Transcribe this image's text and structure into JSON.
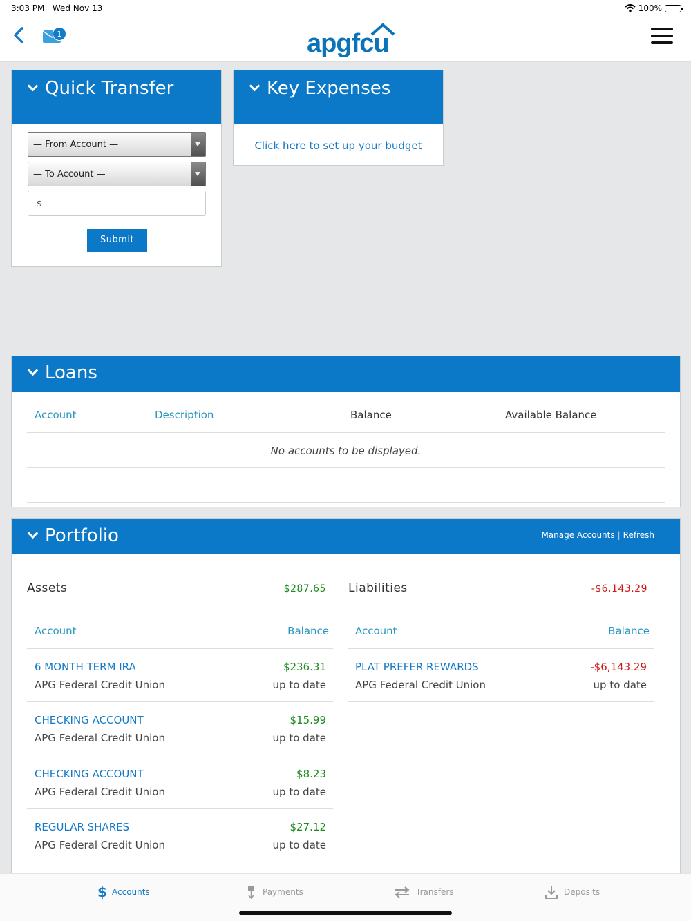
{
  "status": {
    "time": "3:03 PM",
    "date": "Wed Nov 13",
    "battery": "100%"
  },
  "header": {
    "logo_text": "apgfcu",
    "mail_count": "1"
  },
  "quick_transfer": {
    "title": "Quick Transfer",
    "from_account": "— From Account —",
    "to_account": "— To Account —",
    "amount_prefix": "$",
    "submit_label": "Submit"
  },
  "key_expenses": {
    "title": "Key Expenses",
    "link": "Click here to set up your budget"
  },
  "loans": {
    "title": "Loans",
    "columns": [
      "Account",
      "Description",
      "Balance",
      "Available Balance"
    ],
    "empty": "No accounts to be displayed."
  },
  "portfolio": {
    "title": "Portfolio",
    "manage_link": "Manage Accounts",
    "separator": "|",
    "refresh_link": "Refresh",
    "assets": {
      "title": "Assets",
      "total": "$287.65",
      "col_account": "Account",
      "col_balance": "Balance",
      "rows": [
        {
          "name": "6 MONTH TERM IRA",
          "institution": "APG Federal Credit Union",
          "balance": "$236.31",
          "status": "up to date"
        },
        {
          "name": "CHECKING ACCOUNT",
          "institution": "APG Federal Credit Union",
          "balance": "$15.99",
          "status": "up to date"
        },
        {
          "name": "CHECKING ACCOUNT",
          "institution": "APG Federal Credit Union",
          "balance": "$8.23",
          "status": "up to date"
        },
        {
          "name": "REGULAR SHARES",
          "institution": "APG Federal Credit Union",
          "balance": "$27.12",
          "status": "up to date"
        }
      ]
    },
    "liabilities": {
      "title": "Liabilities",
      "total": "-$6,143.29",
      "col_account": "Account",
      "col_balance": "Balance",
      "rows": [
        {
          "name": "PLAT PREFER REWARDS",
          "institution": "APG Federal Credit Union",
          "balance": "-$6,143.29",
          "status": "up to date"
        }
      ]
    }
  },
  "tabs": [
    {
      "label": "Accounts",
      "icon": "dollar-icon",
      "active": true
    },
    {
      "label": "Payments",
      "icon": "payments-icon",
      "active": false
    },
    {
      "label": "Transfers",
      "icon": "transfer-arrows-icon",
      "active": false
    },
    {
      "label": "Deposits",
      "icon": "download-icon",
      "active": false
    }
  ],
  "colors": {
    "brand_blue": "#0c78c8",
    "positive": "#1c8a1c",
    "negative": "#d01818"
  }
}
